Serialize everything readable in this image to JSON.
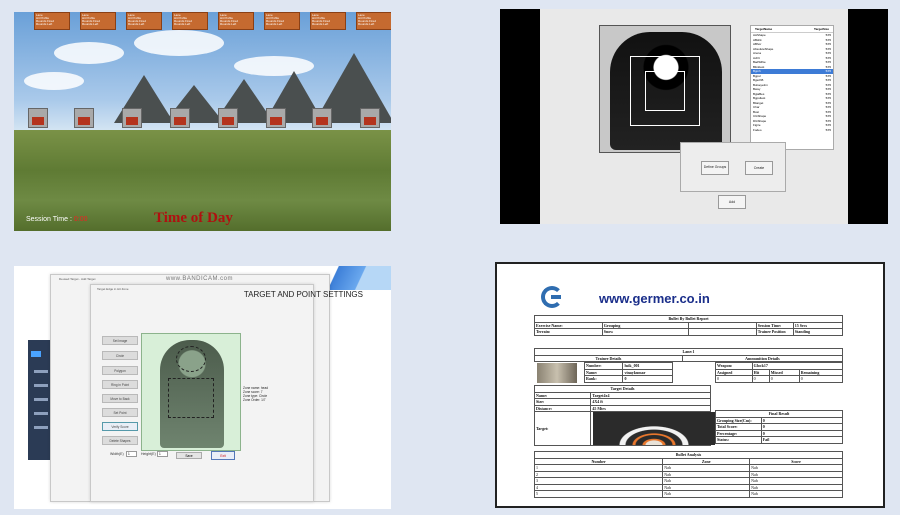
{
  "tile1": {
    "hud_boxes": [
      "Lane\nHit Profile\nRounds Fired\nRounds Left",
      "Lane\nHit Profile\nRounds Fired\nRounds Left",
      "Lane\nHit Profile\nRounds Fired\nRounds Left",
      "Lane\nHit Profile\nRounds Fired\nRounds Left",
      "Lane\nHit Profile\nRounds Fired\nRounds Left",
      "Lane\nHit Profile\nRounds Fired\nRounds Left",
      "Lane\nHit Profile\nRounds Fired\nRounds Left",
      "Lane\nHit Profile\nRounds Fired\nRounds Left"
    ],
    "session_label": "Session Time :",
    "session_value": "0:00",
    "time_of_day": "Time of Day"
  },
  "tile2": {
    "list_header": [
      "TargetName",
      "TargetSize"
    ],
    "list_rows": [
      [
        "AAShape",
        "5X5"
      ],
      [
        "ABshk",
        "5X5"
      ],
      [
        "ABhor",
        "5X5"
      ],
      [
        "AbsoluteShape",
        "5X5"
      ],
      [
        "Arena",
        "5X5"
      ],
      [
        "Axhlt",
        "5X5"
      ],
      [
        "BadSilhie",
        "5X5"
      ],
      [
        "Blinktest",
        "5X5"
      ],
      [
        "Bgmh",
        "5X5"
      ],
      [
        "Bgpsl",
        "5X5"
      ],
      [
        "BgschB",
        "5X5"
      ],
      [
        "Bulseye2m",
        "5X5"
      ],
      [
        "Bway",
        "5X5"
      ],
      [
        "BgtaBes",
        "5X5"
      ],
      [
        "Bgpsltest",
        "5X5"
      ],
      [
        "Bitarget",
        "5X5"
      ],
      [
        "Char",
        "5X5"
      ],
      [
        "Bost",
        "5X5"
      ],
      [
        "CGShape",
        "5X5"
      ],
      [
        "DGShape",
        "5X5"
      ],
      [
        "Figire",
        "5X5"
      ],
      [
        "Fodeo",
        "5X5"
      ]
    ],
    "selected_index": 8,
    "btn_define": "Define Groups",
    "btn_create": "Create",
    "btn_add": "Add"
  },
  "tile3": {
    "bandicam": "www.BANDICAM.com",
    "window_title_back": "Deused Target - Add Target",
    "window_title_front": "Target Edge in Hit Zone",
    "title": "TARGET AND POINT SETTINGS",
    "side_buttons": [
      "Set Image",
      "Circle",
      "Polygon",
      "Ring in Point",
      "Move to Back",
      "Set Point",
      "Verify Score",
      "Delete Shapes"
    ],
    "notes": [
      "Zone name: head",
      "Zone score: 7",
      "Zone type: Circle",
      "Zone Order: 1/7"
    ],
    "width_label": "Width(E)",
    "width_value": "1",
    "height_label": "Height(E)",
    "height_value": "1",
    "save_label": "Save",
    "exit_label": "Exit"
  },
  "tile4": {
    "site": "www.germer.co.in",
    "report_title": "Bullet By Bullet Report",
    "exercise_name_label": "Exercise Name:",
    "exercise_name": "Grouping",
    "session_time_label": "Session Time:",
    "session_time": "15 Secs",
    "terrain_label": "Terrain:",
    "terrain": "Snow",
    "trainee_position_label": "Trainee Position",
    "trainee_position": "Standing",
    "lane": "Lane:1",
    "trainee_details": "Trainee Details",
    "ammunition_details": "Ammunition Details",
    "number_label": "Number:",
    "number": "hsik_001",
    "name_label": "Name:",
    "name": "vinaykumar",
    "rank_label": "Rank:",
    "rank": "0",
    "weapon_label": "Weapon:",
    "weapon": "Glock17",
    "ammo_headers": [
      "Assigned",
      "Hit",
      "Missed",
      "Remaining"
    ],
    "ammo_values": [
      "0",
      "0",
      "0",
      "0"
    ],
    "target_details": "Target Details",
    "tname_label": "Name:",
    "tname": "Target4x4",
    "size_label": "Size:",
    "size": "4X4 ft",
    "distance_label": "Distance:",
    "distance": "45 Mtrs",
    "target_label": "Target:",
    "final_result": "Final Result",
    "result_rows": [
      [
        "Grouping Size(Cm):",
        "0"
      ],
      [
        "Total Score:",
        "0"
      ],
      [
        "Percentage:",
        "0"
      ],
      [
        "Status:",
        "Fail"
      ]
    ],
    "bullet_analysis": "Bullet Analysis",
    "ba_headers": [
      "Number",
      "Zone",
      "Score"
    ],
    "ba_rows": [
      [
        "1",
        "Nah",
        "Nah"
      ],
      [
        "2",
        "Nah",
        "Nah"
      ],
      [
        "3",
        "Nah",
        "Nah"
      ],
      [
        "4",
        "Nah",
        "Nah"
      ],
      [
        "5",
        "Nah",
        "Nah"
      ]
    ]
  }
}
